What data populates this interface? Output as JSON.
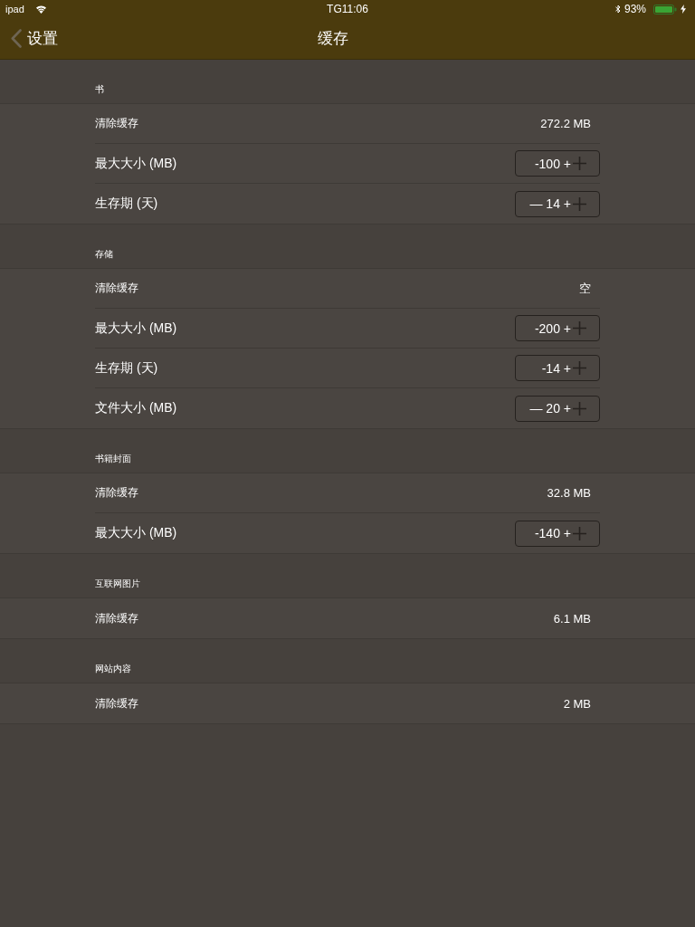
{
  "status_bar": {
    "carrier": "ipad",
    "time": "TG11:06",
    "battery": "93%"
  },
  "nav": {
    "back": "设置",
    "title": "缓存"
  },
  "sections": [
    {
      "header": "书",
      "rows": [
        {
          "kind": "value",
          "label": "清除缓存",
          "value": "272.2 MB"
        },
        {
          "kind": "stepper",
          "label": "最大大小 (MB)",
          "value": "-100 +"
        },
        {
          "kind": "stepper",
          "label": "生存期 (天)",
          "value": "— 14 +"
        }
      ]
    },
    {
      "header": "存储",
      "rows": [
        {
          "kind": "value",
          "label": "清除缓存",
          "value": "空"
        },
        {
          "kind": "stepper",
          "label": "最大大小 (MB)",
          "value": "-200 +"
        },
        {
          "kind": "stepper",
          "label": "生存期 (天)",
          "value": "-14 +"
        },
        {
          "kind": "stepper",
          "label": "文件大小 (MB)",
          "value": "— 20 +"
        }
      ]
    },
    {
      "header": "书籍封面",
      "rows": [
        {
          "kind": "value",
          "label": "清除缓存",
          "value": "32.8 MB"
        },
        {
          "kind": "stepper",
          "label": "最大大小 (MB)",
          "value": "-140 +"
        }
      ]
    },
    {
      "header": "互联网图片",
      "rows": [
        {
          "kind": "value",
          "label": "清除缓存",
          "value": "6.1 MB"
        }
      ]
    },
    {
      "header": "网站内容",
      "rows": [
        {
          "kind": "value",
          "label": "清除缓存",
          "value": "2 MB"
        }
      ]
    }
  ]
}
